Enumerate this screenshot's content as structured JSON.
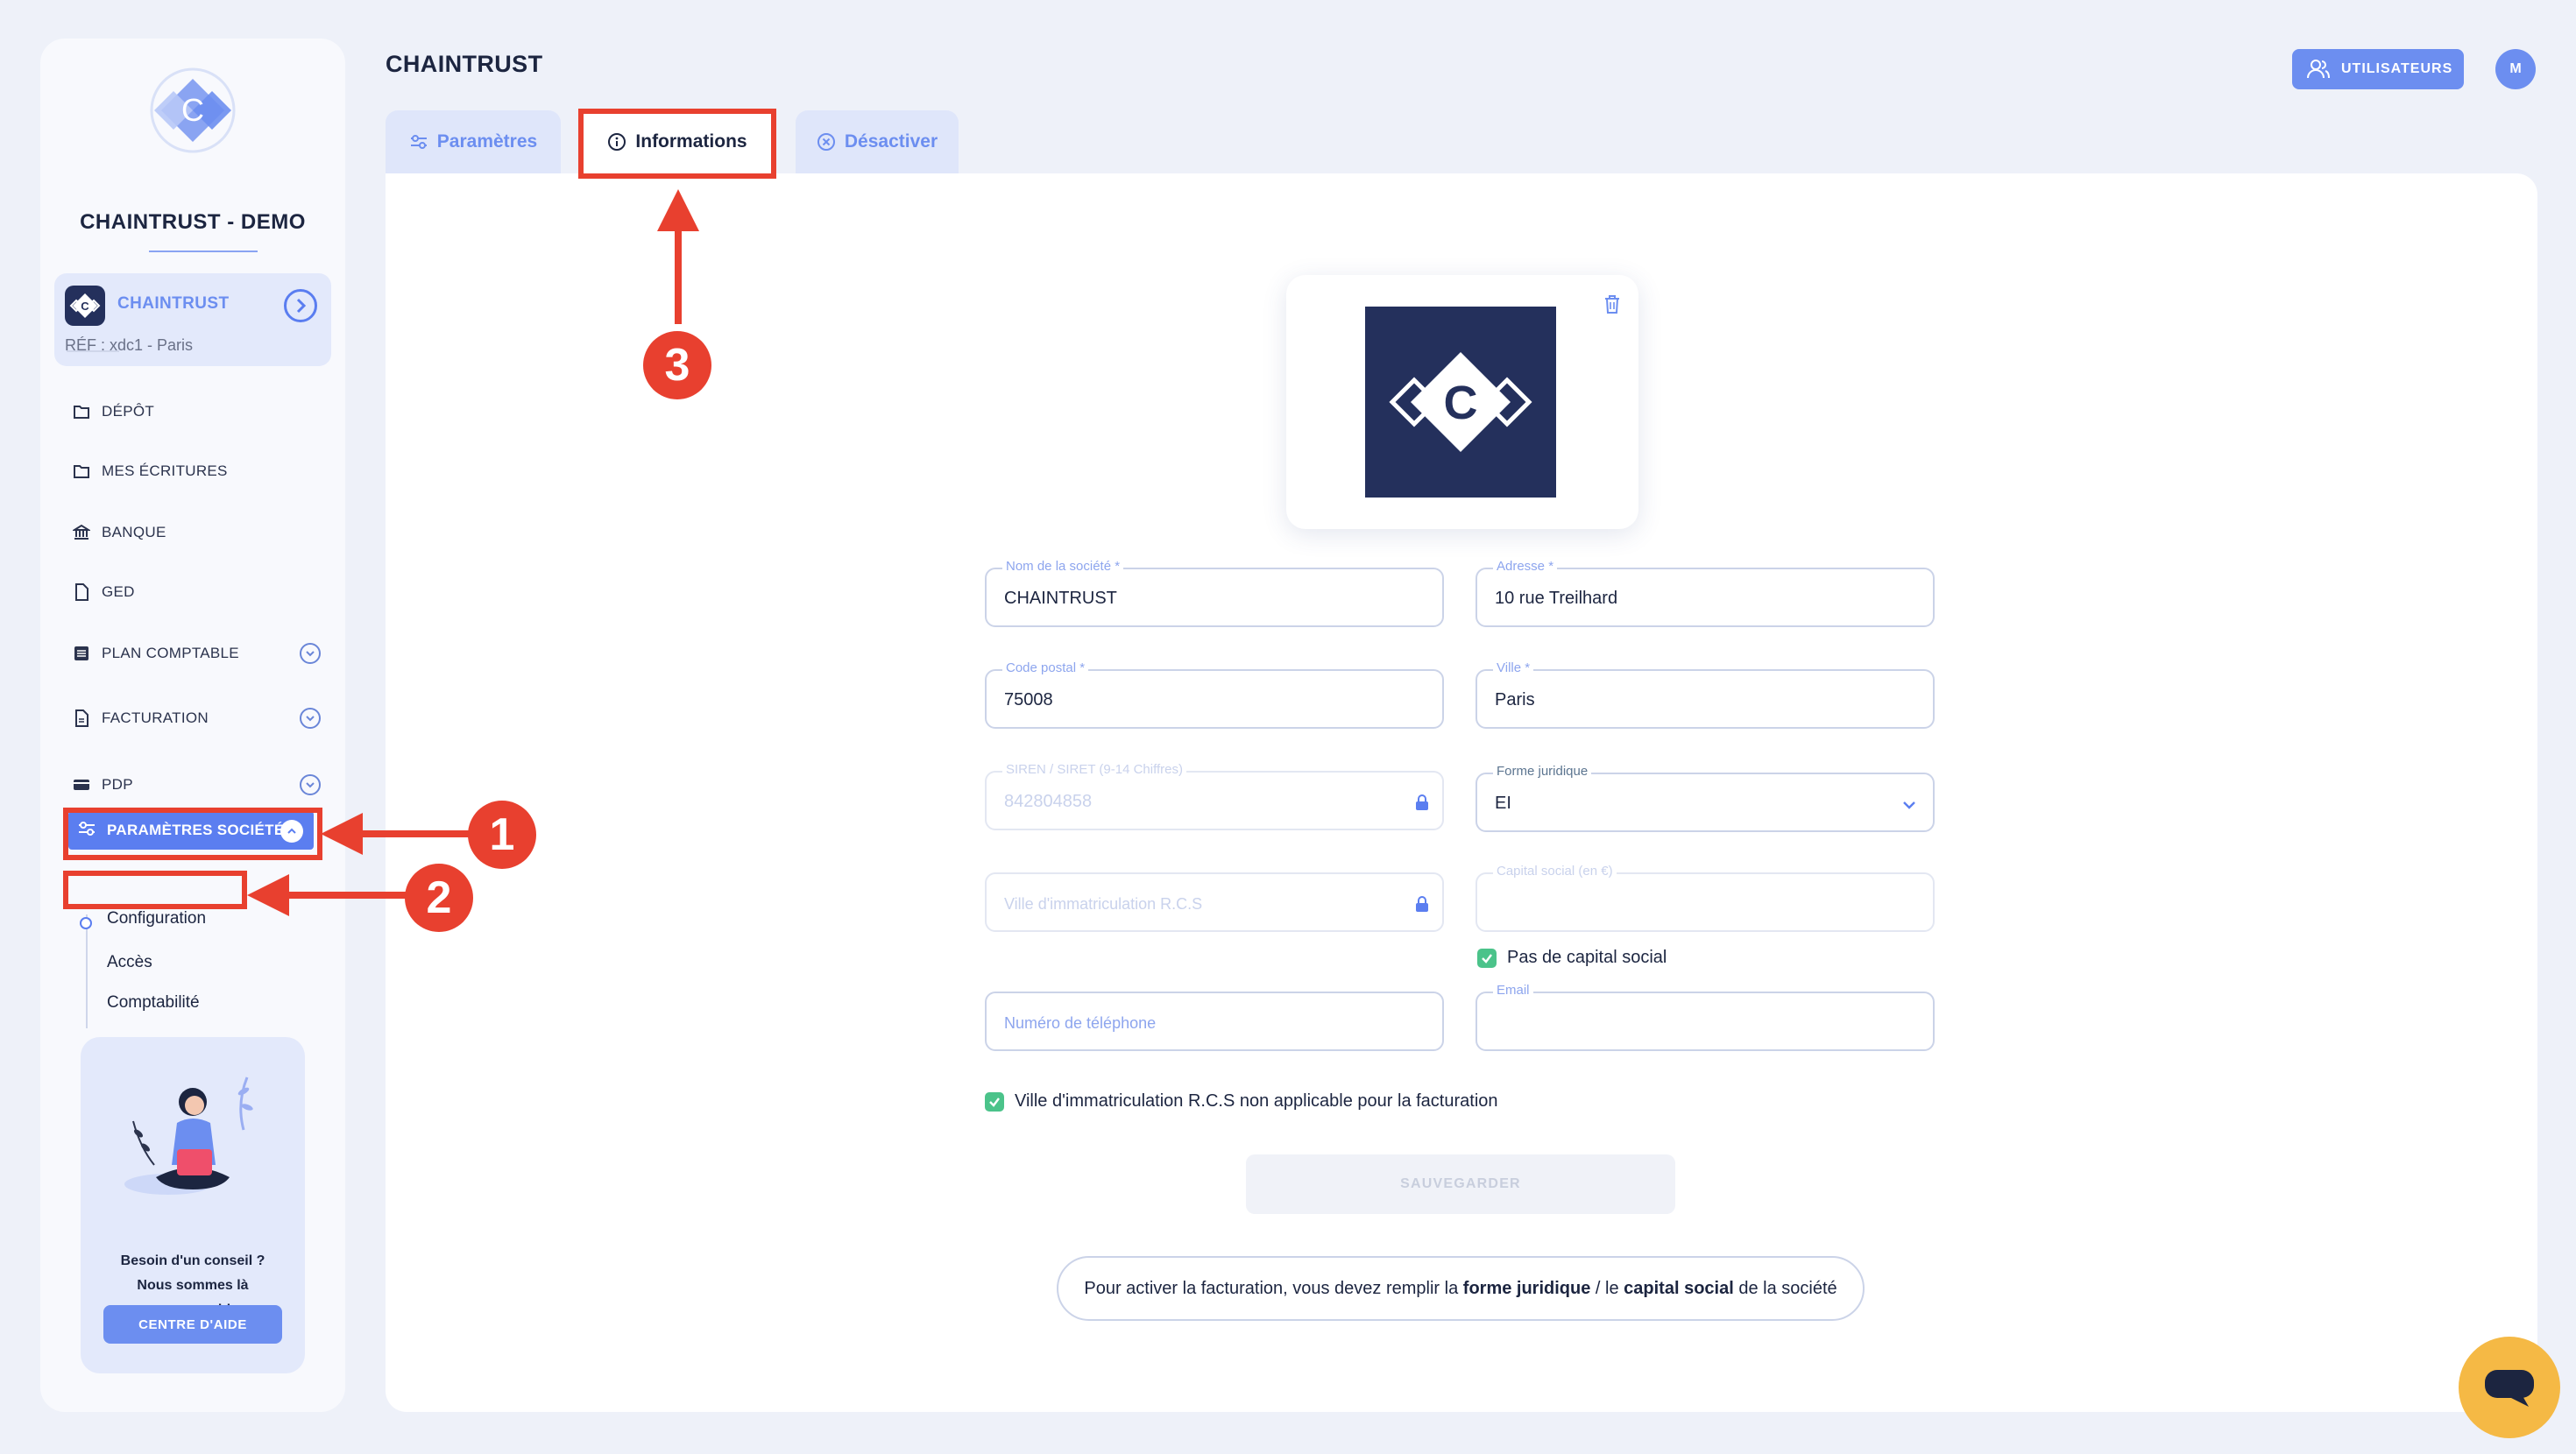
{
  "sidebar": {
    "company_title": "CHAINTRUST - DEMO",
    "company_card": {
      "name": "CHAINTRUST",
      "ref": "RÉF : xdc1 - Paris"
    },
    "nav": [
      {
        "label": "DÉPÔT",
        "icon": "folder-icon"
      },
      {
        "label": "MES ÉCRITURES",
        "icon": "folder-icon"
      },
      {
        "label": "BANQUE",
        "icon": "bank-icon"
      },
      {
        "label": "GED",
        "icon": "document-icon"
      },
      {
        "label": "PLAN COMPTABLE",
        "icon": "list-icon"
      },
      {
        "label": "FACTURATION",
        "icon": "invoice-icon"
      },
      {
        "label": "PDP",
        "icon": "card-icon"
      }
    ],
    "active_section": {
      "label": "PARAMÈTRES SOCIÉTÉ",
      "icon": "sliders-icon"
    },
    "sub_items": [
      "Configuration",
      "Accès",
      "Comptabilité"
    ],
    "help": {
      "line1": "Besoin d'un conseil ?",
      "line2": "Nous sommes là",
      "line3": "pour vous aider.",
      "button": "CENTRE D'AIDE"
    }
  },
  "header": {
    "title": "CHAINTRUST",
    "users_button": "UTILISATEURS",
    "avatar_initial": "M"
  },
  "tabs": [
    {
      "label": "Paramètres",
      "icon": "sliders-icon",
      "active": false
    },
    {
      "label": "Informations",
      "icon": "info-icon",
      "active": true
    },
    {
      "label": "Désactiver",
      "icon": "close-circle-icon",
      "active": false
    }
  ],
  "form": {
    "company_name": {
      "label": "Nom de la société *",
      "value": "CHAINTRUST"
    },
    "address": {
      "label": "Adresse *",
      "value": "10 rue Treilhard"
    },
    "postal_code": {
      "label": "Code postal *",
      "value": "75008"
    },
    "city": {
      "label": "Ville *",
      "value": "Paris"
    },
    "siren": {
      "label": "SIREN / SIRET (9-14 Chiffres)",
      "value": "842804858"
    },
    "legal_form": {
      "label": "Forme juridique",
      "value": "EI"
    },
    "rcs_city": {
      "placeholder": "Ville d'immatriculation R.C.S"
    },
    "capital": {
      "label": "Capital social (en €)"
    },
    "no_capital": {
      "label": "Pas de capital social",
      "checked": true
    },
    "phone": {
      "placeholder": "Numéro de téléphone"
    },
    "email": {
      "label": "Email"
    },
    "rcs_not_applicable": {
      "label": "Ville d'immatriculation R.C.S non applicable pour la facturation",
      "checked": true
    },
    "save_button": "SAUVEGARDER",
    "notice": {
      "part1": "Pour activer la facturation, vous devez remplir la ",
      "bold1": "forme juridique",
      "part2": " / le ",
      "bold2": "capital social",
      "part3": " de la société"
    }
  },
  "annotations": [
    "1",
    "2",
    "3"
  ],
  "colors": {
    "accent": "#5b7ef0",
    "navy": "#24305c",
    "annotation_red": "#e8402f",
    "check_green": "#4bc38a",
    "chat_yellow": "#f5b945"
  }
}
